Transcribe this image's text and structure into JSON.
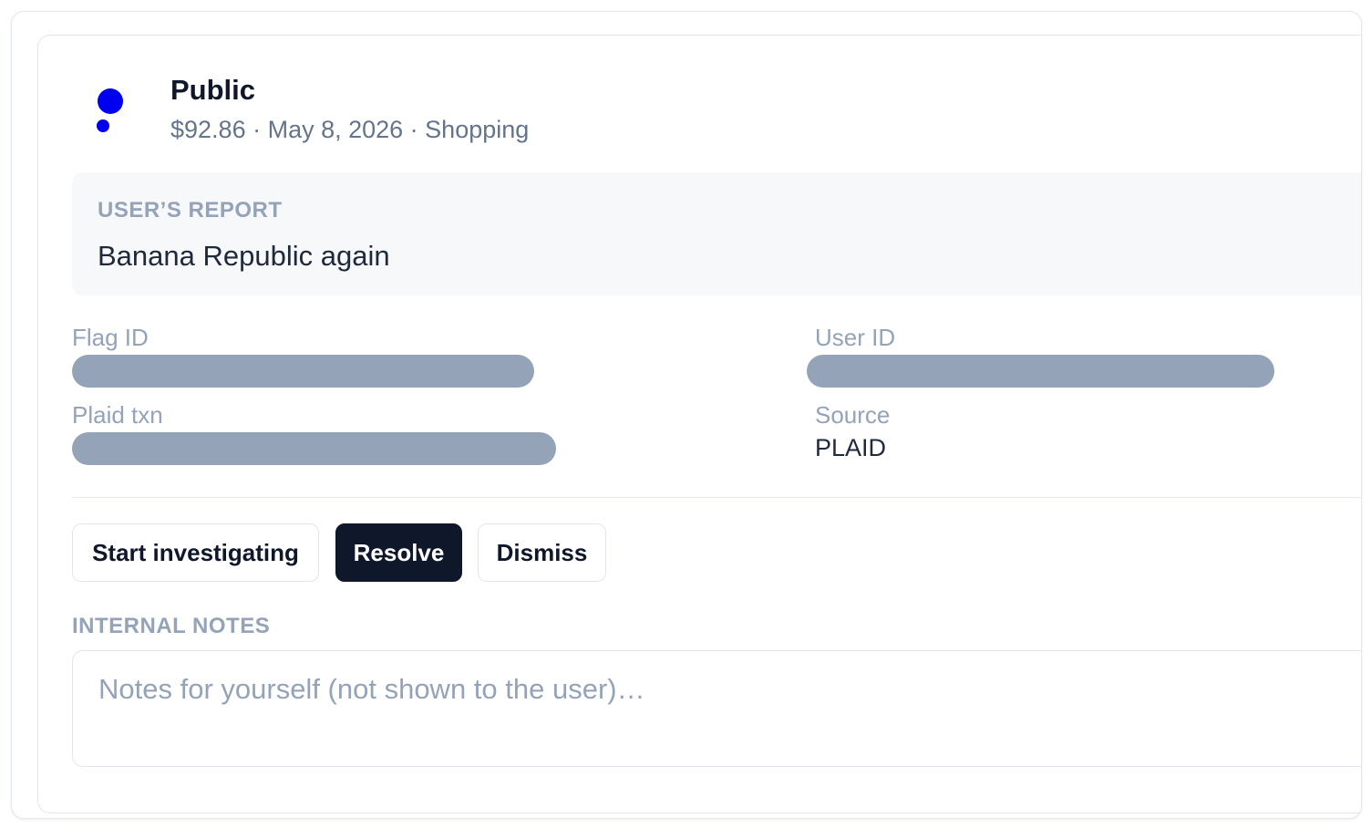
{
  "merchant": {
    "logo_icon": "public-logo-icon",
    "logo_color": "#0000ee",
    "name": "Public",
    "meta": "$92.86 · May 8, 2026 · Shopping"
  },
  "report": {
    "label": "USER’S REPORT",
    "text": "Banana Republic again"
  },
  "fields": {
    "flag_id_label": "Flag ID",
    "user_id_label": "User ID",
    "plaid_txn_label": "Plaid txn",
    "source_label": "Source",
    "source_value": "PLAID",
    "redacted_color": "#94a3b8"
  },
  "actions": {
    "start_investigating": "Start investigating",
    "resolve": "Resolve",
    "dismiss": "Dismiss"
  },
  "notes": {
    "label": "INTERNAL NOTES",
    "placeholder": "Notes for yourself (not shown to the user)…",
    "value": ""
  }
}
